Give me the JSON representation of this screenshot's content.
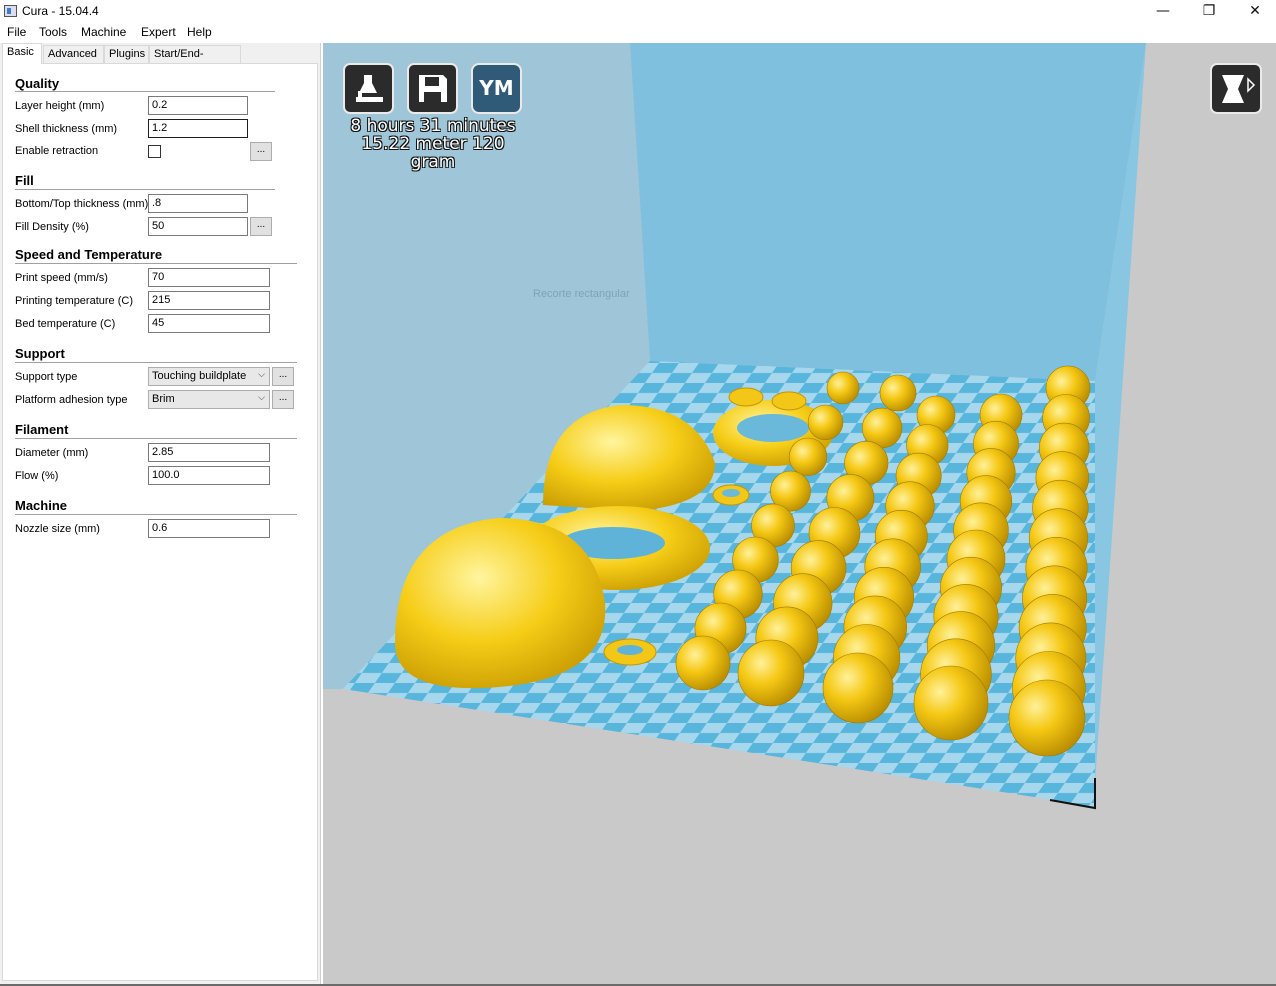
{
  "window": {
    "title": "Cura - 15.04.4",
    "controls": {
      "minimize": "—",
      "maximize": "❐",
      "close": "✕"
    }
  },
  "menu": [
    "File",
    "Tools",
    "Machine",
    "Expert",
    "Help"
  ],
  "tabs": [
    "Basic",
    "Advanced",
    "Plugins",
    "Start/End-GCode"
  ],
  "active_tab": "Basic",
  "settings": {
    "quality": {
      "title": "Quality",
      "layer_height": {
        "label": "Layer height (mm)",
        "value": "0.2"
      },
      "shell_thickness": {
        "label": "Shell thickness (mm)",
        "value": "1.2"
      },
      "enable_retraction": {
        "label": "Enable retraction",
        "checked": false,
        "more": "..."
      }
    },
    "fill": {
      "title": "Fill",
      "bottom_top_thickness": {
        "label": "Bottom/Top thickness (mm)",
        "value": ".8"
      },
      "fill_density": {
        "label": "Fill Density (%)",
        "value": "50",
        "more": "..."
      }
    },
    "speed": {
      "title": "Speed and Temperature",
      "print_speed": {
        "label": "Print speed (mm/s)",
        "value": "70"
      },
      "printing_temp": {
        "label": "Printing temperature (C)",
        "value": "215"
      },
      "bed_temp": {
        "label": "Bed temperature (C)",
        "value": "45"
      }
    },
    "support": {
      "title": "Support",
      "support_type": {
        "label": "Support type",
        "value": "Touching buildplate",
        "more": "..."
      },
      "adhesion_type": {
        "label": "Platform adhesion type",
        "value": "Brim",
        "more": "..."
      }
    },
    "filament": {
      "title": "Filament",
      "diameter": {
        "label": "Diameter (mm)",
        "value": "2.85"
      },
      "flow": {
        "label": "Flow (%)",
        "value": "100.0"
      }
    },
    "machine": {
      "title": "Machine",
      "nozzle_size": {
        "label": "Nozzle size (mm)",
        "value": "0.6"
      }
    }
  },
  "viewport": {
    "toolbar": {
      "load_icon": "load-model-icon",
      "save_icon": "save-icon",
      "ym_label": "YM"
    },
    "estimate": {
      "time": "8 hours 31 minutes",
      "material": "15.22 meter 120 gram"
    },
    "overlay_text": "Recorte rectangular",
    "view_mode_icon": "view-mode-icon",
    "colors": {
      "background": "#c9c9c9",
      "volume_wall": "#8ec8e0",
      "plate_light": "#a7d7ec",
      "plate_dark": "#58b6dc",
      "model": "#f2c718"
    }
  }
}
